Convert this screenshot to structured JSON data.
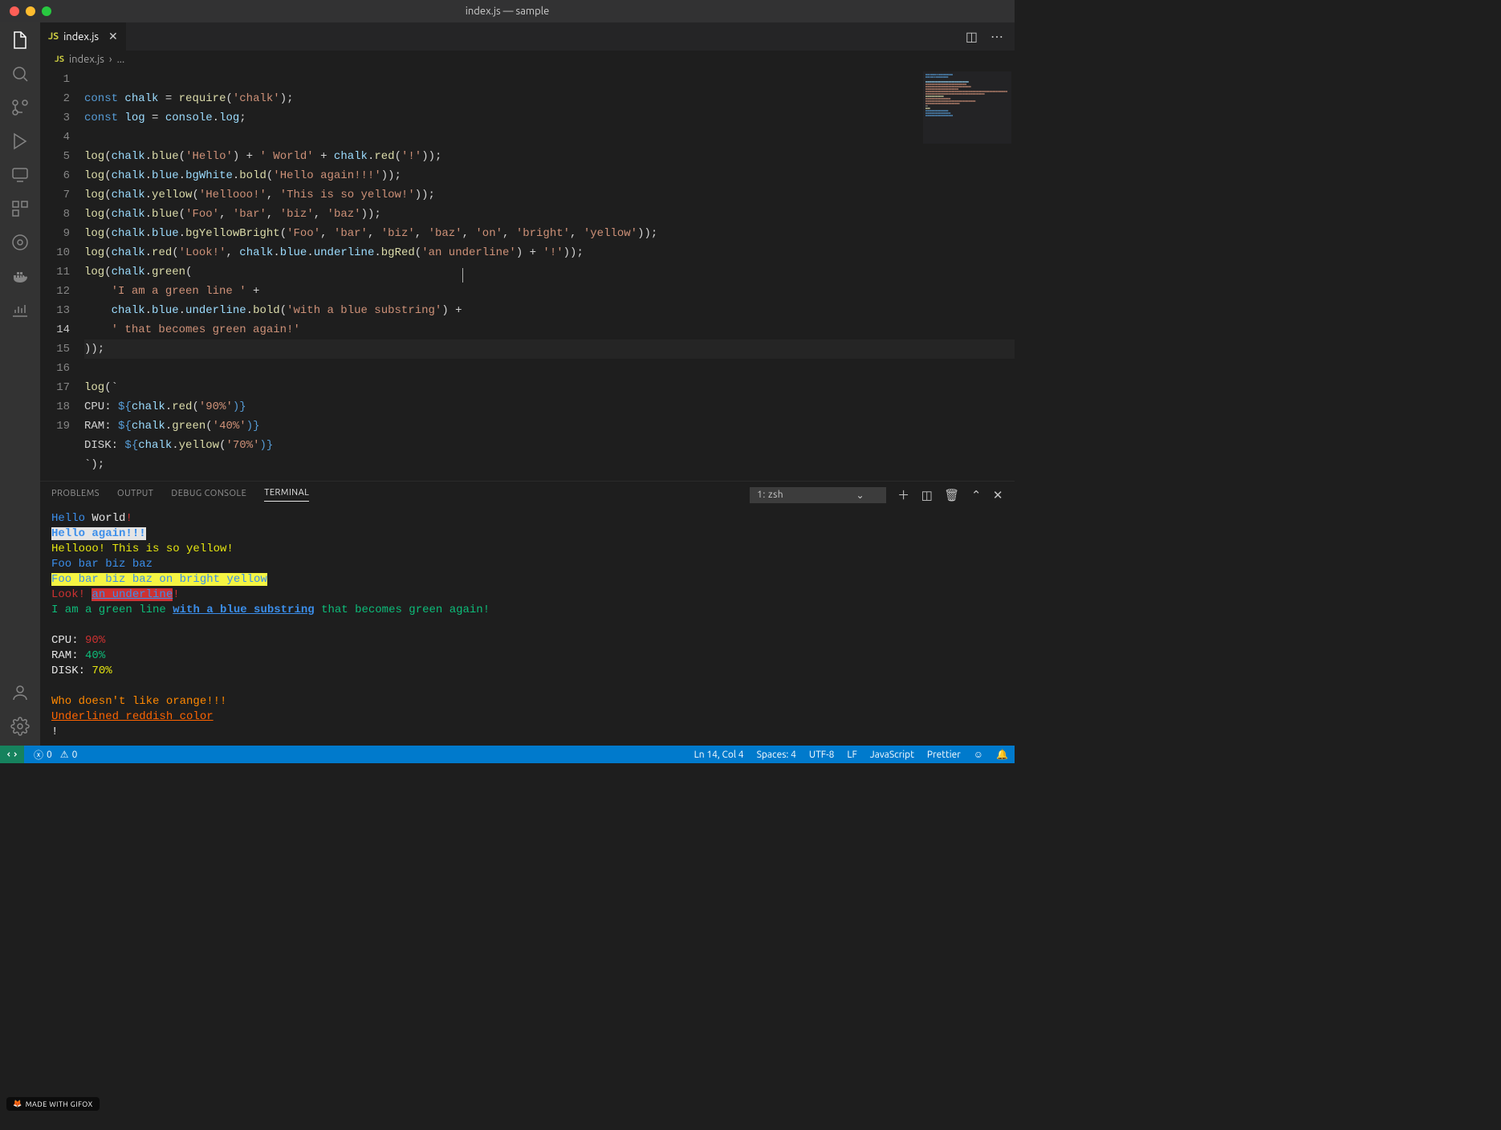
{
  "window": {
    "title": "index.js — sample"
  },
  "tab": {
    "icon": "JS",
    "name": "index.js"
  },
  "breadcrumb": {
    "icon": "JS",
    "file": "index.js",
    "sep": "›",
    "rest": "..."
  },
  "code": {
    "lines": [
      1,
      2,
      3,
      4,
      5,
      6,
      7,
      8,
      9,
      10,
      11,
      12,
      13,
      14,
      15,
      16,
      17,
      18,
      19
    ]
  },
  "src": {
    "l1_const": "const ",
    "l1_chalk": "chalk",
    "l1_eq": " = ",
    "l1_require": "require",
    "l1_p1": "(",
    "l1_str": "'chalk'",
    "l1_p2": ");",
    "l2_const": "const ",
    "l2_log": "log",
    "l2_eq": " = ",
    "l2_console": "console",
    "l2_dot": ".",
    "l2_logp": "log",
    "l2_semi": ";",
    "l4": "log",
    "l4b": "(",
    "l4c": "chalk",
    "l4d": ".",
    "l4e": "blue",
    "l4f": "(",
    "l4g": "'Hello'",
    "l4h": ") + ",
    "l4i": "' World'",
    "l4j": " + ",
    "l4k": "chalk",
    "l4l": ".",
    "l4m": "red",
    "l4n": "(",
    "l4o": "'!'",
    "l4p": "));",
    "l5a": "log",
    "l5b": "(",
    "l5c": "chalk",
    "l5d": ".",
    "l5e": "blue",
    "l5f": ".",
    "l5g": "bgWhite",
    "l5h": ".",
    "l5i": "bold",
    "l5j": "(",
    "l5k": "'Hello again!!!'",
    "l5l": "));",
    "l6a": "log",
    "l6b": "(",
    "l6c": "chalk",
    "l6d": ".",
    "l6e": "yellow",
    "l6f": "(",
    "l6g": "'Hellooo!'",
    "l6h": ", ",
    "l6i": "'This is so yellow!'",
    "l6j": "));",
    "l7a": "log",
    "l7b": "(",
    "l7c": "chalk",
    "l7d": ".",
    "l7e": "blue",
    "l7f": "(",
    "l7g": "'Foo'",
    "l7h": ", ",
    "l7i": "'bar'",
    "l7j": ", ",
    "l7k": "'biz'",
    "l7l": ", ",
    "l7m": "'baz'",
    "l7n": "));",
    "l8a": "log",
    "l8b": "(",
    "l8c": "chalk",
    "l8d": ".",
    "l8e": "blue",
    "l8f": ".",
    "l8g": "bgYellowBright",
    "l8h": "(",
    "l8i": "'Foo'",
    "l8j": ", ",
    "l8k": "'bar'",
    "l8l": ", ",
    "l8m": "'biz'",
    "l8n": ", ",
    "l8o": "'baz'",
    "l8p": ", ",
    "l8q": "'on'",
    "l8r": ", ",
    "l8s": "'bright'",
    "l8t": ", ",
    "l8u": "'yellow'",
    "l8v": "));",
    "l9a": "log",
    "l9b": "(",
    "l9c": "chalk",
    "l9d": ".",
    "l9e": "red",
    "l9f": "(",
    "l9g": "'Look!'",
    "l9h": ", ",
    "l9i": "chalk",
    "l9j": ".",
    "l9k": "blue",
    "l9l": ".",
    "l9m": "underline",
    "l9n": ".",
    "l9o": "bgRed",
    "l9p": "(",
    "l9q": "'an underline'",
    "l9r": ") + ",
    "l9s": "'!'",
    "l9t": "));",
    "l10a": "log",
    "l10b": "(",
    "l10c": "chalk",
    "l10d": ".",
    "l10e": "green",
    "l10f": "(",
    "l11a": "    ",
    "l11b": "'I am a green line '",
    "l11c": " +",
    "l12a": "    ",
    "l12b": "chalk",
    "l12c": ".",
    "l12d": "blue",
    "l12e": ".",
    "l12f": "underline",
    "l12g": ".",
    "l12h": "bold",
    "l12i": "(",
    "l12j": "'with a blue substring'",
    "l12k": ") +",
    "l13a": "    ",
    "l13b": "' that becomes green again!'",
    "l14a": "));",
    "l15a": "log",
    "l15b": "(`",
    "l16a": "CPU: ",
    "l16b": "${",
    "l16c": "chalk",
    "l16d": ".",
    "l16e": "red",
    "l16f": "(",
    "l16g": "'90%'",
    "l16h": ")}",
    "l17a": "RAM: ",
    "l17b": "${",
    "l17c": "chalk",
    "l17d": ".",
    "l17e": "green",
    "l17f": "(",
    "l17g": "'40%'",
    "l17h": ")}",
    "l18a": "DISK: ",
    "l18b": "${",
    "l18c": "chalk",
    "l18d": ".",
    "l18e": "yellow",
    "l18f": "(",
    "l18g": "'70%'",
    "l18h": ")}",
    "l19a": "`);"
  },
  "panel": {
    "tabs": {
      "problems": "PROBLEMS",
      "output": "OUTPUT",
      "debug": "DEBUG CONSOLE",
      "terminal": "TERMINAL"
    },
    "select": "1: zsh"
  },
  "term": {
    "l1a": "Hello",
    "l1b": " World",
    "l1c": "!",
    "l2": "Hello again!!!",
    "l3": "Hellooo! This is so yellow!",
    "l4": "Foo bar biz baz",
    "l5": "Foo bar biz baz on bright yellow",
    "l6a": "Look!",
    "l6b": " ",
    "l6c": "an underline",
    "l6d": "!",
    "l7a": "I am a green line ",
    "l7b": "with a blue substring",
    "l7c": " that becomes green again!",
    "cpu_l": "CPU: ",
    "cpu_v": "90%",
    "ram_l": "RAM: ",
    "ram_v": "40%",
    "disk_l": "DISK: ",
    "disk_v": "70%",
    "orange": "Who doesn't like orange!!!",
    "reddish": "Underlined reddish color",
    "excl": "!"
  },
  "status": {
    "errors": "0",
    "warnings": "0",
    "ln": "Ln 14, Col 4",
    "spaces": "Spaces: 4",
    "enc": "UTF-8",
    "eol": "LF",
    "lang": "JavaScript",
    "prettier": "Prettier"
  },
  "gifox": "MADE WITH GIFOX"
}
